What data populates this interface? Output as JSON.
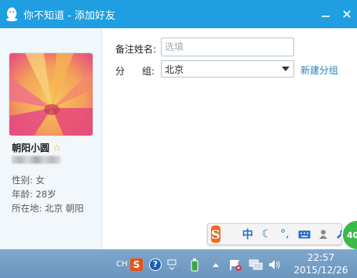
{
  "window": {
    "title": "你不知道 - 添加好友"
  },
  "profile": {
    "nickname": "朝阳小圆",
    "gender": "性别: 女",
    "age": "年龄: 28岁",
    "location": "所在地: 北京  朝阳"
  },
  "form": {
    "remark_label": "备注姓名:",
    "remark_placeholder": "选填",
    "group_label": "分      组:",
    "group_value": "北京",
    "new_group_link": "新建分组"
  },
  "ime": {
    "logo": "S",
    "mode": "中"
  },
  "badge": {
    "value": "40"
  },
  "taskbar": {
    "lang": "CH",
    "time": "22:57",
    "date": "2015/12/26"
  },
  "colors": {
    "titlebar": "#1f9ee1",
    "link": "#1e7fc8",
    "ime_logo": "#f36a1f",
    "badge": "#3db94a"
  }
}
